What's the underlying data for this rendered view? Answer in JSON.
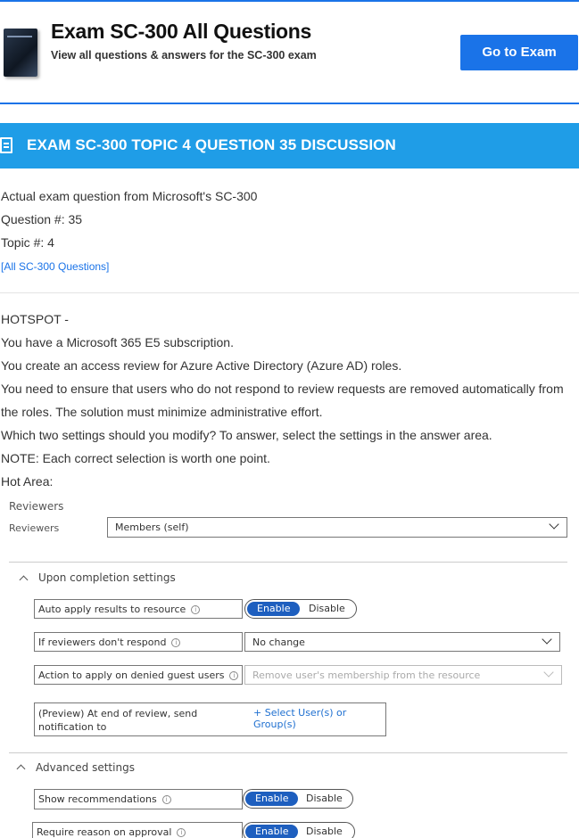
{
  "header": {
    "title": "Exam SC-300 All Questions",
    "subtitle": "View all questions & answers for the SC-300 exam",
    "go_button": "Go to Exam"
  },
  "banner": {
    "title": "EXAM SC-300 TOPIC 4 QUESTION 35 DISCUSSION"
  },
  "meta": {
    "source": "Actual exam question from Microsoft's SC-300",
    "question_no": "Question #: 35",
    "topic_no": "Topic #: 4",
    "all_link": "[All SC-300 Questions]"
  },
  "question": {
    "lines": [
      "HOTSPOT -",
      "You have a Microsoft 365 E5 subscription.",
      "You create an access review for Azure Active Directory (Azure AD) roles.",
      "You need to ensure that users who do not respond to review requests are removed automatically from",
      "the roles. The solution must minimize administrative effort.",
      "Which two settings should you modify? To answer, select the settings in the answer area.",
      "NOTE: Each correct selection is worth one point.",
      "Hot Area:"
    ]
  },
  "hot_area": {
    "reviewers_heading": "Reviewers",
    "reviewers_label": "Reviewers",
    "reviewers_value": "Members (self)",
    "upon_completion": "Upon completion settings",
    "auto_apply": "Auto apply results to resource",
    "if_no_respond": "If reviewers don't respond",
    "if_no_respond_value": "No change",
    "action_denied": "Action to apply on denied guest users",
    "action_denied_value": "Remove user's membership from the resource",
    "preview_line1": "(Preview) At end of review, send",
    "preview_line2": "notification to",
    "select_users": "+ Select User(s) or Group(s)",
    "advanced": "Advanced settings",
    "show_recs": "Show recommendations",
    "require_reason": "Require reason on approval",
    "enable": "Enable",
    "disable": "Disable",
    "info_glyph": "i"
  }
}
